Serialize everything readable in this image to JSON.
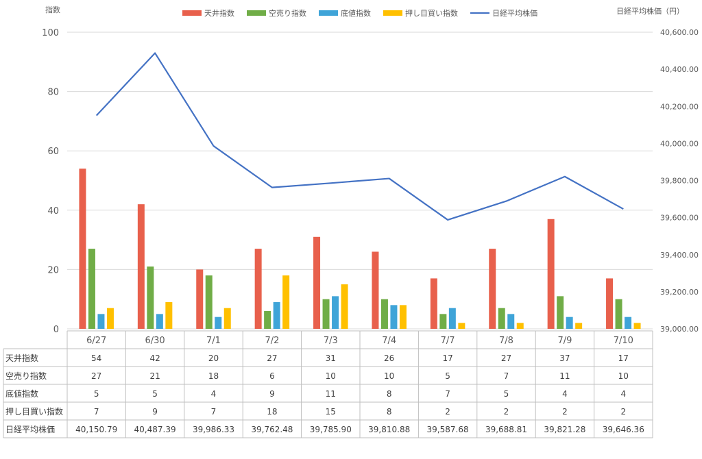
{
  "chart_data": {
    "type": "bar",
    "categories": [
      "6/27",
      "6/30",
      "7/1",
      "7/2",
      "7/3",
      "7/4",
      "7/7",
      "7/8",
      "7/9",
      "7/10"
    ],
    "series": [
      {
        "name": "天井指数",
        "type": "bar",
        "axis": "left",
        "color": "#E8604C",
        "values": [
          54,
          42,
          20,
          27,
          31,
          26,
          17,
          27,
          37,
          17
        ]
      },
      {
        "name": "空売り指数",
        "type": "bar",
        "axis": "left",
        "color": "#70AD47",
        "values": [
          27,
          21,
          18,
          6,
          10,
          10,
          5,
          7,
          11,
          10
        ]
      },
      {
        "name": "底値指数",
        "type": "bar",
        "axis": "left",
        "color": "#3FA4D8",
        "values": [
          5,
          5,
          4,
          9,
          11,
          8,
          7,
          5,
          4,
          4
        ]
      },
      {
        "name": "押し目買い指数",
        "type": "bar",
        "axis": "left",
        "color": "#FFC000",
        "values": [
          7,
          9,
          7,
          18,
          15,
          8,
          2,
          2,
          2,
          2
        ]
      },
      {
        "name": "日経平均株価",
        "type": "line",
        "axis": "right",
        "color": "#4472C4",
        "values": [
          40150.79,
          40487.39,
          39986.33,
          39762.48,
          39785.9,
          39810.88,
          39587.68,
          39688.81,
          39821.28,
          39646.36
        ]
      }
    ],
    "table_values": {
      "天井指数": [
        "54",
        "42",
        "20",
        "27",
        "31",
        "26",
        "17",
        "27",
        "37",
        "17"
      ],
      "空売り指数": [
        "27",
        "21",
        "18",
        "6",
        "10",
        "10",
        "5",
        "7",
        "11",
        "10"
      ],
      "底値指数": [
        "5",
        "5",
        "4",
        "9",
        "11",
        "8",
        "7",
        "5",
        "4",
        "4"
      ],
      "押し目買い指数": [
        "7",
        "9",
        "7",
        "18",
        "15",
        "8",
        "2",
        "2",
        "2",
        "2"
      ],
      "日経平均株価": [
        "40,150.79",
        "40,487.39",
        "39,986.33",
        "39,762.48",
        "39,785.90",
        "39,810.88",
        "39,587.68",
        "39,688.81",
        "39,821.28",
        "39,646.36"
      ]
    },
    "ylabel": "指数",
    "y2label": "日経平均株価（円）",
    "ylim": [
      0,
      100
    ],
    "y_ticks": [
      "0",
      "20",
      "40",
      "60",
      "80",
      "100"
    ],
    "y2lim": [
      39000,
      40600
    ],
    "y2_ticks": [
      "39,000.00",
      "39,200.00",
      "39,400.00",
      "39,600.00",
      "39,800.00",
      "40,000.00",
      "40,200.00",
      "40,400.00",
      "40,600.00"
    ],
    "grid": true,
    "legend": "top-center",
    "data_table": true
  }
}
